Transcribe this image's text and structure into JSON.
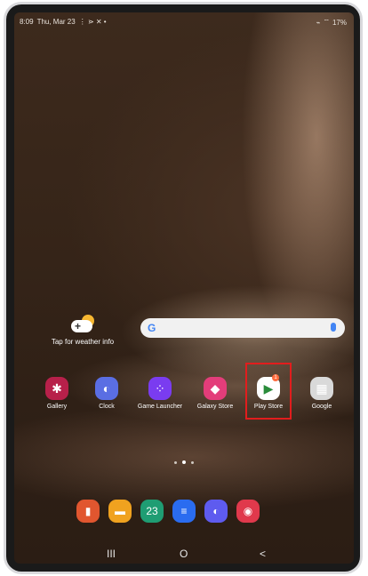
{
  "status": {
    "time": "8:09",
    "date": "Thu, Mar 23",
    "battery": "17%"
  },
  "weather": {
    "label": "Tap for weather info"
  },
  "search": {
    "logo": "G"
  },
  "apps": [
    {
      "label": "Gallery",
      "icon": "✱",
      "color": "#b7204a"
    },
    {
      "label": "Clock",
      "icon": "◐",
      "color": "#5a6ee3"
    },
    {
      "label": "Game Launcher",
      "icon": "⁘",
      "color": "#7a3cf0"
    },
    {
      "label": "Galaxy Store",
      "icon": "◆",
      "color": "#e33d7a"
    },
    {
      "label": "Play Store",
      "icon": "▶",
      "color": "#ffffff",
      "badge": "1"
    },
    {
      "label": "Google",
      "icon": "▦",
      "color": "#d9d9d9"
    }
  ],
  "dock": [
    {
      "name": "notes",
      "icon": "▮",
      "color": "#e1562f"
    },
    {
      "name": "files",
      "icon": "▬",
      "color": "#f0a21f"
    },
    {
      "name": "calendar",
      "icon": "23",
      "color": "#1f9d73"
    },
    {
      "name": "messages",
      "icon": "≡",
      "color": "#2a6cf0"
    },
    {
      "name": "internet",
      "icon": "◐",
      "color": "#5e5bef"
    },
    {
      "name": "camera",
      "icon": "◉",
      "color": "#e0394c"
    }
  ],
  "nav": {
    "recents": "III",
    "home": "O",
    "back": "<"
  }
}
